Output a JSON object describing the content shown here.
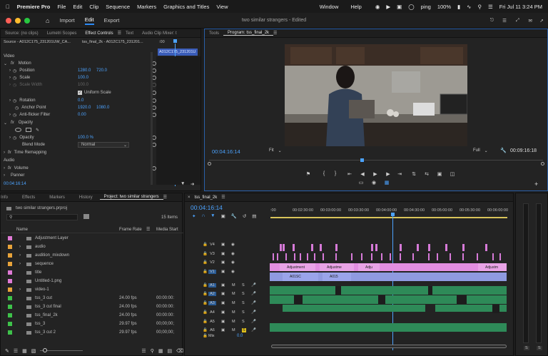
{
  "menu": {
    "app_name": "Premiere Pro",
    "items": [
      "File",
      "Edit",
      "Clip",
      "Sequence",
      "Markers",
      "Graphics and Titles",
      "View",
      "Window",
      "Help"
    ],
    "status": {
      "user": "ping",
      "battery": "100%",
      "datetime": "Fri Jul 11  3:24 PM"
    }
  },
  "workspace": {
    "tabs": [
      "Import",
      "Edit",
      "Export"
    ],
    "active": "Edit",
    "title": "two similar strangers - Edited"
  },
  "source_panel": {
    "tabs": [
      "Source: (no clips)",
      "Lumetri Scopes",
      "Effect Controls",
      "Text",
      "Audio Clip Mixer: t"
    ],
    "active": "Effect Controls",
    "header_left": "Source - A012C175_231201UW_CA...",
    "header_right": "tss_final_2k - A012C175_231201...",
    "time_label": ":00",
    "clip_label": "A012C175_231201U",
    "video_label": "Video",
    "motion_label": "Motion",
    "position": {
      "label": "Position",
      "x": "1280.0",
      "y": "720.0"
    },
    "scale": {
      "label": "Scale",
      "value": "100.0"
    },
    "scale_width": {
      "label": "Scale Width",
      "value": "100.0"
    },
    "uniform": "Uniform Scale",
    "rotation": {
      "label": "Rotation",
      "value": "0.0"
    },
    "anchor": {
      "label": "Anchor Point",
      "x": "1920.0",
      "y": "1080.0"
    },
    "flicker": {
      "label": "Anti-flicker Filter",
      "value": "0.00"
    },
    "opacity_section": "Opacity",
    "opacity": {
      "label": "Opacity",
      "value": "100.0 %"
    },
    "blend": {
      "label": "Blend Mode",
      "value": "Normal"
    },
    "remap": "Time Remapping",
    "audio_label": "Audio",
    "volume": "Volume",
    "panner": "Panner",
    "timecode": "00:04:16:14"
  },
  "program": {
    "tabs": [
      "Tools",
      "Program: tss_final_2k"
    ],
    "active": "Program: tss_final_2k",
    "timecode": "00:04:16:14",
    "fit": "Fit",
    "quality": "Full",
    "duration": "00:09:16:18"
  },
  "project": {
    "tabs": [
      "Info",
      "Effects",
      "Markers",
      "History",
      "Project: two similar strangers"
    ],
    "active": "Project: two similar strangers",
    "file": "two similar strangers.prproj",
    "count": "15 Items",
    "columns": {
      "name": "Name",
      "fps": "Frame Rate",
      "start": "Media Start"
    },
    "items": [
      {
        "name": "Adjustment Layer",
        "color": "#e07ad6",
        "folder": false,
        "fps": "",
        "start": ""
      },
      {
        "name": "audio",
        "color": "#e8a33a",
        "folder": true,
        "fps": "",
        "start": ""
      },
      {
        "name": "audition_mixdown",
        "color": "#e8a33a",
        "folder": true,
        "fps": "",
        "start": ""
      },
      {
        "name": "sequence",
        "color": "#e8a33a",
        "folder": true,
        "fps": "",
        "start": ""
      },
      {
        "name": "title",
        "color": "#e07ad6",
        "folder": false,
        "fps": "",
        "start": ""
      },
      {
        "name": "Untitled-1.png",
        "color": "#e07ad6",
        "folder": false,
        "fps": "",
        "start": ""
      },
      {
        "name": "video-1",
        "color": "#e8a33a",
        "folder": true,
        "fps": "",
        "start": ""
      },
      {
        "name": "tss_3 cut",
        "color": "#3ec24a",
        "folder": false,
        "fps": "24.00 fps",
        "start": "00:00:00:"
      },
      {
        "name": "tss_3 cut final",
        "color": "#3ec24a",
        "folder": false,
        "fps": "24.00 fps",
        "start": "00:00:00:"
      },
      {
        "name": "tss_final_2k",
        "color": "#3ec24a",
        "folder": false,
        "fps": "24.00 fps",
        "start": "00:00:00:"
      },
      {
        "name": "tss_3",
        "color": "#3ec24a",
        "folder": false,
        "fps": "29.97 fps",
        "start": "00;00;00;"
      },
      {
        "name": "tss_3 cut 2",
        "color": "#3ec24a",
        "folder": false,
        "fps": "29.97 fps",
        "start": "00;00;00;"
      }
    ]
  },
  "timeline": {
    "tab": "tss_final_2k",
    "timecode": "00:04:16:14",
    "ruler": [
      ":00",
      "00:02:30:00",
      "00:03:00:00",
      "00:03:30:00",
      "00:04:00:00",
      "00:04:30:00",
      "00:05:00:00",
      "00:05:30:00",
      "00:06:00:00"
    ],
    "tracks": [
      {
        "name": "V4",
        "type": "video"
      },
      {
        "name": "V3",
        "type": "video"
      },
      {
        "name": "V2",
        "type": "video"
      },
      {
        "name": "V1",
        "type": "video"
      },
      {
        "name": "A1",
        "type": "audio"
      },
      {
        "name": "A2",
        "type": "audio"
      },
      {
        "name": "A3",
        "type": "audio"
      },
      {
        "name": "A4",
        "type": "audio"
      },
      {
        "name": "A5",
        "type": "audio"
      },
      {
        "name": "A6",
        "type": "audio"
      }
    ],
    "v2_clips": [
      "Adjustment",
      "Adjustme",
      "Adju",
      "Adjustm"
    ],
    "v1_clips": [
      "A01SC",
      "A015"
    ],
    "mix": {
      "label": "Mix",
      "value": "0.0"
    }
  },
  "meter": {
    "labels": [
      "S",
      "S"
    ]
  }
}
